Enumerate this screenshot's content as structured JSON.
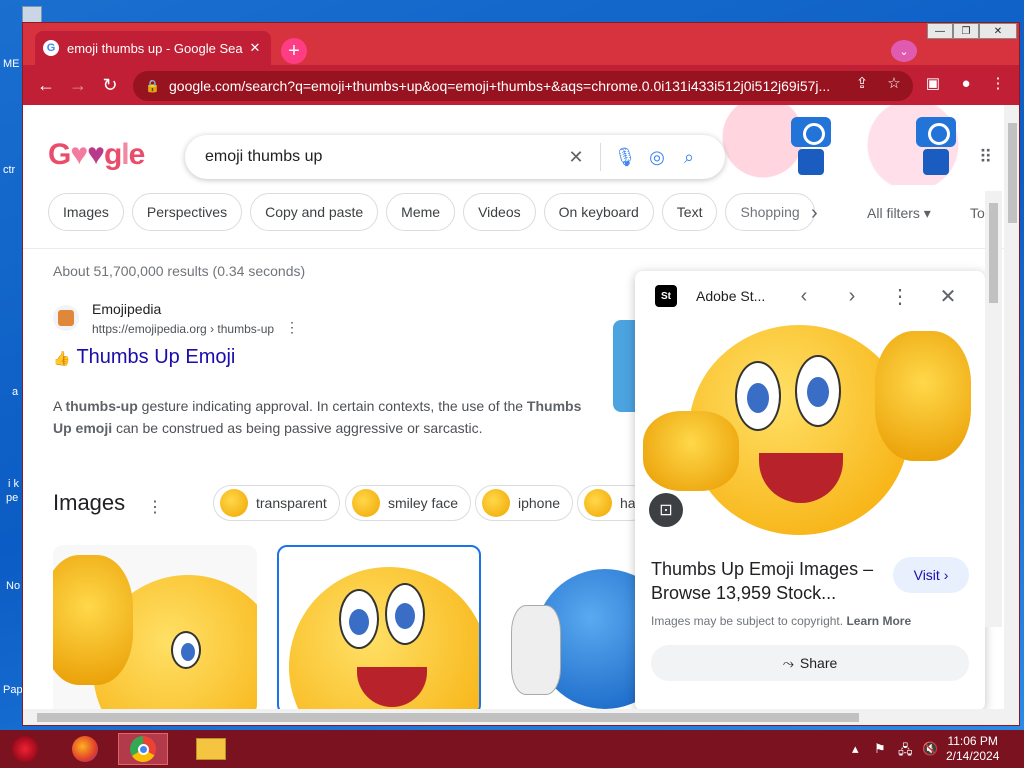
{
  "desktop": {
    "labels": [
      "ME",
      "ctr",
      "a",
      "i k",
      "pe",
      "No",
      "Pap"
    ]
  },
  "browser": {
    "tab_title": "emoji thumbs up - Google Search",
    "tab_close": "✕",
    "new_tab": "+",
    "url": "google.com/search?q=emoji+thumbs+up&oq=emoji+thumbs+&aqs=chrome.0.0i131i433i512j0i512j69i57j...",
    "window_controls": {
      "minimize": "—",
      "restore": "❐",
      "close": "✕"
    }
  },
  "google": {
    "logo": "Google",
    "query": "emoji thumbs up",
    "chips": [
      "Images",
      "Perspectives",
      "Copy and paste",
      "Meme",
      "Videos",
      "On keyboard",
      "Text",
      "Shopping"
    ],
    "all_filters": "All filters",
    "tools": "Tools",
    "stats": "About 51,700,000 results (0.34 seconds)"
  },
  "result": {
    "site_name": "Emojipedia",
    "site_url": "https://emojipedia.org › thumbs-up",
    "title": "Thumbs Up Emoji",
    "snippet_html_parts": {
      "p1": "A ",
      "b1": "thumbs-up",
      "p2": " gesture indicating approval. In certain contexts, the use of the ",
      "b2": "Thumbs Up emoji",
      "p3": " can be construed as being passive aggressive or sarcastic."
    }
  },
  "images_section": {
    "heading": "Images",
    "chips": [
      "transparent",
      "smiley face",
      "iphone",
      "ha"
    ]
  },
  "side_panel": {
    "source": "Adobe St...",
    "source_icon": "St",
    "title": "Thumbs Up Emoji Images – Browse 13,959 Stock...",
    "visit": "Visit",
    "copyright_prefix": "Images may be subject to copyright.",
    "learn_more": "Learn More",
    "share": "Share"
  },
  "taskbar": {
    "time": "11:06 PM",
    "date": "2/14/2024"
  },
  "colors": {
    "chrome_frame": "#d6333f",
    "toolbar": "#c01f35",
    "link": "#1a0dab",
    "emoji_yellow": "#ffc400"
  }
}
